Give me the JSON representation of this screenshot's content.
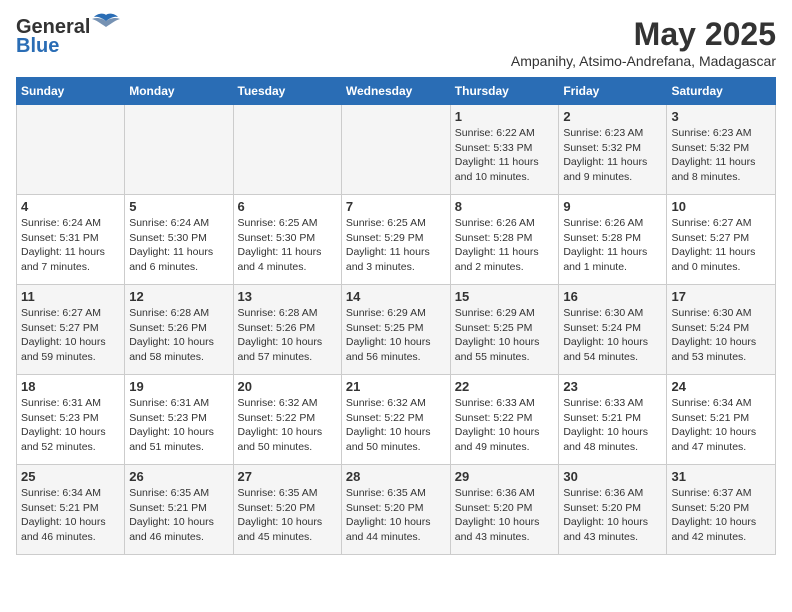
{
  "logo": {
    "general": "General",
    "blue": "Blue"
  },
  "title": "May 2025",
  "subtitle": "Ampanihy, Atsimo-Andrefana, Madagascar",
  "days_of_week": [
    "Sunday",
    "Monday",
    "Tuesday",
    "Wednesday",
    "Thursday",
    "Friday",
    "Saturday"
  ],
  "weeks": [
    [
      {
        "day": "",
        "info": ""
      },
      {
        "day": "",
        "info": ""
      },
      {
        "day": "",
        "info": ""
      },
      {
        "day": "",
        "info": ""
      },
      {
        "day": "1",
        "info": "Sunrise: 6:22 AM\nSunset: 5:33 PM\nDaylight: 11 hours and 10 minutes."
      },
      {
        "day": "2",
        "info": "Sunrise: 6:23 AM\nSunset: 5:32 PM\nDaylight: 11 hours and 9 minutes."
      },
      {
        "day": "3",
        "info": "Sunrise: 6:23 AM\nSunset: 5:32 PM\nDaylight: 11 hours and 8 minutes."
      }
    ],
    [
      {
        "day": "4",
        "info": "Sunrise: 6:24 AM\nSunset: 5:31 PM\nDaylight: 11 hours and 7 minutes."
      },
      {
        "day": "5",
        "info": "Sunrise: 6:24 AM\nSunset: 5:30 PM\nDaylight: 11 hours and 6 minutes."
      },
      {
        "day": "6",
        "info": "Sunrise: 6:25 AM\nSunset: 5:30 PM\nDaylight: 11 hours and 4 minutes."
      },
      {
        "day": "7",
        "info": "Sunrise: 6:25 AM\nSunset: 5:29 PM\nDaylight: 11 hours and 3 minutes."
      },
      {
        "day": "8",
        "info": "Sunrise: 6:26 AM\nSunset: 5:28 PM\nDaylight: 11 hours and 2 minutes."
      },
      {
        "day": "9",
        "info": "Sunrise: 6:26 AM\nSunset: 5:28 PM\nDaylight: 11 hours and 1 minute."
      },
      {
        "day": "10",
        "info": "Sunrise: 6:27 AM\nSunset: 5:27 PM\nDaylight: 11 hours and 0 minutes."
      }
    ],
    [
      {
        "day": "11",
        "info": "Sunrise: 6:27 AM\nSunset: 5:27 PM\nDaylight: 10 hours and 59 minutes."
      },
      {
        "day": "12",
        "info": "Sunrise: 6:28 AM\nSunset: 5:26 PM\nDaylight: 10 hours and 58 minutes."
      },
      {
        "day": "13",
        "info": "Sunrise: 6:28 AM\nSunset: 5:26 PM\nDaylight: 10 hours and 57 minutes."
      },
      {
        "day": "14",
        "info": "Sunrise: 6:29 AM\nSunset: 5:25 PM\nDaylight: 10 hours and 56 minutes."
      },
      {
        "day": "15",
        "info": "Sunrise: 6:29 AM\nSunset: 5:25 PM\nDaylight: 10 hours and 55 minutes."
      },
      {
        "day": "16",
        "info": "Sunrise: 6:30 AM\nSunset: 5:24 PM\nDaylight: 10 hours and 54 minutes."
      },
      {
        "day": "17",
        "info": "Sunrise: 6:30 AM\nSunset: 5:24 PM\nDaylight: 10 hours and 53 minutes."
      }
    ],
    [
      {
        "day": "18",
        "info": "Sunrise: 6:31 AM\nSunset: 5:23 PM\nDaylight: 10 hours and 52 minutes."
      },
      {
        "day": "19",
        "info": "Sunrise: 6:31 AM\nSunset: 5:23 PM\nDaylight: 10 hours and 51 minutes."
      },
      {
        "day": "20",
        "info": "Sunrise: 6:32 AM\nSunset: 5:22 PM\nDaylight: 10 hours and 50 minutes."
      },
      {
        "day": "21",
        "info": "Sunrise: 6:32 AM\nSunset: 5:22 PM\nDaylight: 10 hours and 50 minutes."
      },
      {
        "day": "22",
        "info": "Sunrise: 6:33 AM\nSunset: 5:22 PM\nDaylight: 10 hours and 49 minutes."
      },
      {
        "day": "23",
        "info": "Sunrise: 6:33 AM\nSunset: 5:21 PM\nDaylight: 10 hours and 48 minutes."
      },
      {
        "day": "24",
        "info": "Sunrise: 6:34 AM\nSunset: 5:21 PM\nDaylight: 10 hours and 47 minutes."
      }
    ],
    [
      {
        "day": "25",
        "info": "Sunrise: 6:34 AM\nSunset: 5:21 PM\nDaylight: 10 hours and 46 minutes."
      },
      {
        "day": "26",
        "info": "Sunrise: 6:35 AM\nSunset: 5:21 PM\nDaylight: 10 hours and 46 minutes."
      },
      {
        "day": "27",
        "info": "Sunrise: 6:35 AM\nSunset: 5:20 PM\nDaylight: 10 hours and 45 minutes."
      },
      {
        "day": "28",
        "info": "Sunrise: 6:35 AM\nSunset: 5:20 PM\nDaylight: 10 hours and 44 minutes."
      },
      {
        "day": "29",
        "info": "Sunrise: 6:36 AM\nSunset: 5:20 PM\nDaylight: 10 hours and 43 minutes."
      },
      {
        "day": "30",
        "info": "Sunrise: 6:36 AM\nSunset: 5:20 PM\nDaylight: 10 hours and 43 minutes."
      },
      {
        "day": "31",
        "info": "Sunrise: 6:37 AM\nSunset: 5:20 PM\nDaylight: 10 hours and 42 minutes."
      }
    ]
  ]
}
